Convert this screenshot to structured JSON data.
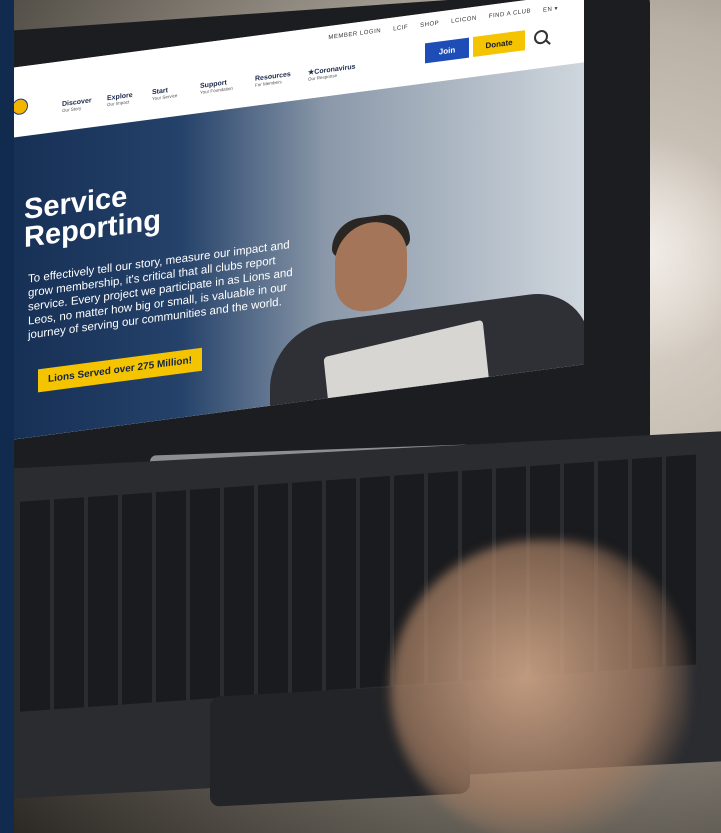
{
  "website": {
    "utility_nav": [
      "MEMBER LOGIN",
      "LCIF",
      "SHOP",
      "LCICON",
      "FIND A CLUB",
      "EN ▾"
    ],
    "actions": {
      "join": "Join",
      "donate": "Donate"
    },
    "main_nav": [
      {
        "label": "Discover",
        "sub": "Our Story"
      },
      {
        "label": "Explore",
        "sub": "Our Impact"
      },
      {
        "label": "Start",
        "sub": "Your Service"
      },
      {
        "label": "Support",
        "sub": "Your Foundation"
      },
      {
        "label": "Resources",
        "sub": "For Members"
      },
      {
        "label": "★Coronavirus",
        "sub": "Our Response"
      }
    ],
    "hero": {
      "title": "Service Reporting",
      "body": "To effectively tell our story, measure our impact and grow membership, it's critical that all clubs report service. Every project we participate in as Lions and Leos, no matter how big or small, is valuable in our journey of serving our communities and the world.",
      "cta": "Lions Served over 275 Million!"
    }
  },
  "colors": {
    "navy": "#102b4d",
    "join_blue": "#1e4db7",
    "donate_yellow": "#f5c400",
    "cta_yellow": "#f5c400"
  },
  "icons": {
    "search": "search-icon",
    "logo": "lions-logo"
  }
}
